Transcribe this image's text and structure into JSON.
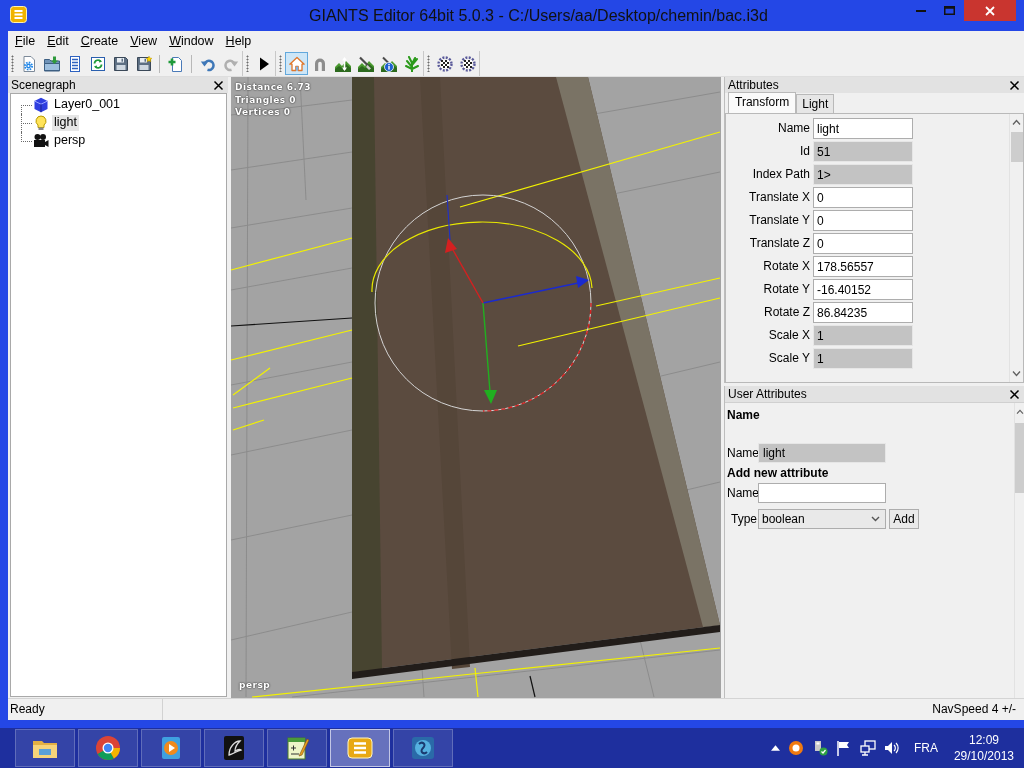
{
  "window": {
    "title": "GIANTS Editor 64bit 5.0.3 - C:/Users/aa/Desktop/chemin/bac.i3d"
  },
  "menu": [
    "File",
    "Edit",
    "Create",
    "View",
    "Window",
    "Help"
  ],
  "toolbar": {
    "groups": [
      {
        "tools": [
          {
            "pressed": false,
            "disabled": false
          },
          {
            "pressed": false,
            "disabled": false
          },
          {
            "pressed": false,
            "disabled": false
          },
          {
            "pressed": false,
            "disabled": false
          },
          {
            "pressed": false,
            "disabled": false
          },
          {
            "pressed": false,
            "disabled": false
          },
          {
            "pressed": false,
            "disabled": false
          },
          {
            "pressed": false,
            "disabled": false
          },
          {
            "pressed": false,
            "disabled": true
          }
        ]
      },
      {
        "tools": [
          {
            "pressed": false,
            "disabled": false
          }
        ]
      },
      {
        "tools": [
          {
            "pressed": true,
            "disabled": false
          },
          {
            "pressed": false,
            "disabled": false
          },
          {
            "pressed": false,
            "disabled": false
          },
          {
            "pressed": false,
            "disabled": false
          },
          {
            "pressed": false,
            "disabled": false
          },
          {
            "pressed": false,
            "disabled": false
          }
        ]
      },
      {
        "tools": [
          {
            "pressed": false,
            "disabled": false
          },
          {
            "pressed": false,
            "disabled": false
          }
        ]
      }
    ]
  },
  "scenegraph": {
    "title": "Scenegraph",
    "items": [
      {
        "label": "Layer0_001",
        "kind": "shape",
        "selected": false
      },
      {
        "label": "light",
        "kind": "light",
        "selected": true
      },
      {
        "label": "persp",
        "kind": "camera",
        "selected": false
      }
    ]
  },
  "viewport": {
    "stats": [
      "Distance 6.73",
      "Triangles 0",
      "Vertices 0"
    ],
    "camera": "persp"
  },
  "attributes": {
    "title": "Attributes",
    "tabs": [
      {
        "label": "Transform",
        "selected": true
      },
      {
        "label": "Light",
        "selected": false
      }
    ],
    "fields": [
      {
        "label": "Name",
        "value": "light",
        "readonly": false
      },
      {
        "label": "Id",
        "value": "51",
        "readonly": true
      },
      {
        "label": "Index Path",
        "value": "1>",
        "readonly": true
      },
      {
        "label": "Translate X",
        "value": "0",
        "readonly": false
      },
      {
        "label": "Translate Y",
        "value": "0",
        "readonly": false
      },
      {
        "label": "Translate Z",
        "value": "0",
        "readonly": false
      },
      {
        "label": "Rotate X",
        "value": "178.56557",
        "readonly": false
      },
      {
        "label": "Rotate Y",
        "value": "-16.40152",
        "readonly": false
      },
      {
        "label": "Rotate Z",
        "value": "86.84235",
        "readonly": false
      },
      {
        "label": "Scale X",
        "value": "1",
        "readonly": true
      },
      {
        "label": "Scale Y",
        "value": "1",
        "readonly": true
      }
    ]
  },
  "user_attributes": {
    "title": "User Attributes",
    "heading": "Name",
    "current": {
      "label": "Name",
      "value": "light",
      "readonly": true
    },
    "add_heading": "Add new attribute",
    "new_name": {
      "label": "Name"
    },
    "type": {
      "label": "Type",
      "value": "boolean"
    },
    "add_button": "Add"
  },
  "status_bar": {
    "message": "Ready",
    "nav_speed": "NavSpeed 4 +/-"
  },
  "taskbar": {
    "apps": [
      {
        "active": false
      },
      {
        "active": false
      },
      {
        "active": false
      },
      {
        "active": false
      },
      {
        "active": false
      },
      {
        "active": true
      },
      {
        "active": false
      }
    ],
    "language": "FRA",
    "time": "12:09",
    "date": "29/10/2013"
  }
}
